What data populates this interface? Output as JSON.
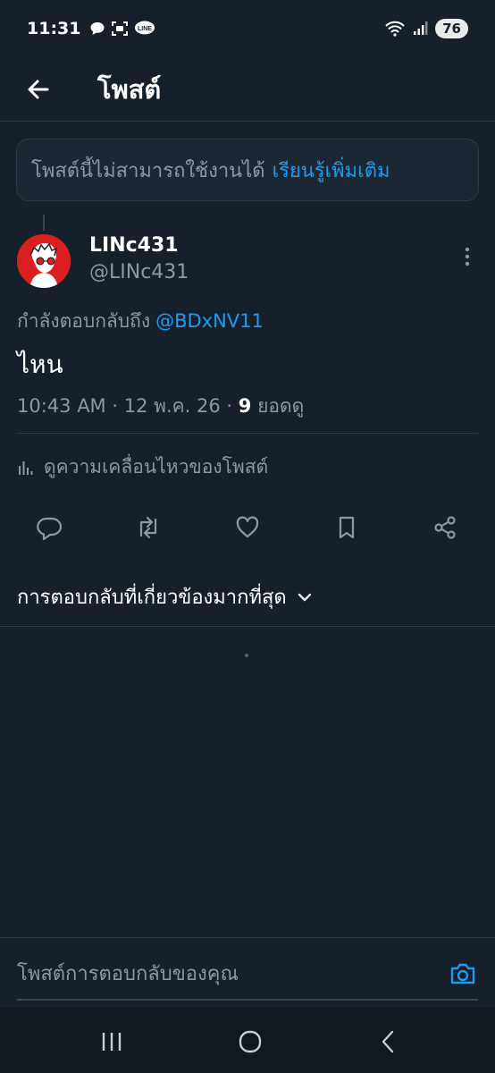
{
  "status_bar": {
    "time": "11:31",
    "battery": "76"
  },
  "header": {
    "title": "โพสต์"
  },
  "notice": {
    "text": "โพสต์นี้ไม่สามารถใช้งานได้",
    "link": "เรียนรู้เพิ่มเติม"
  },
  "post": {
    "display_name": "LINc431",
    "handle": "@LINc431",
    "reply_prefix": "กำลังตอบกลับถึง",
    "reply_to": "@BDxNV11",
    "text": "ไหน",
    "timestamp": "10:43 AM · 12 พ.ค. 26 · ",
    "views_count": "9",
    "views_label": " ยอดดู",
    "engagements_label": "ดูความเคลื่อนไหวของโพสต์"
  },
  "sort": {
    "label": "การตอบกลับที่เกี่ยวข้องมากที่สุด"
  },
  "compose": {
    "placeholder": "โพสต์การตอบกลับของคุณ"
  },
  "icons": {
    "back": "arrow-left-icon",
    "more": "more-vertical-icon",
    "reply": "comment-icon",
    "repost": "repost-icon",
    "like": "heart-icon",
    "bookmark": "bookmark-icon",
    "share": "share-icon",
    "camera": "camera-icon",
    "analytics": "bar-chart-icon"
  },
  "colors": {
    "background": "#15202b",
    "accent": "#1d9bf0",
    "muted": "#8b98a5",
    "avatar_bg": "#d91f1f"
  }
}
